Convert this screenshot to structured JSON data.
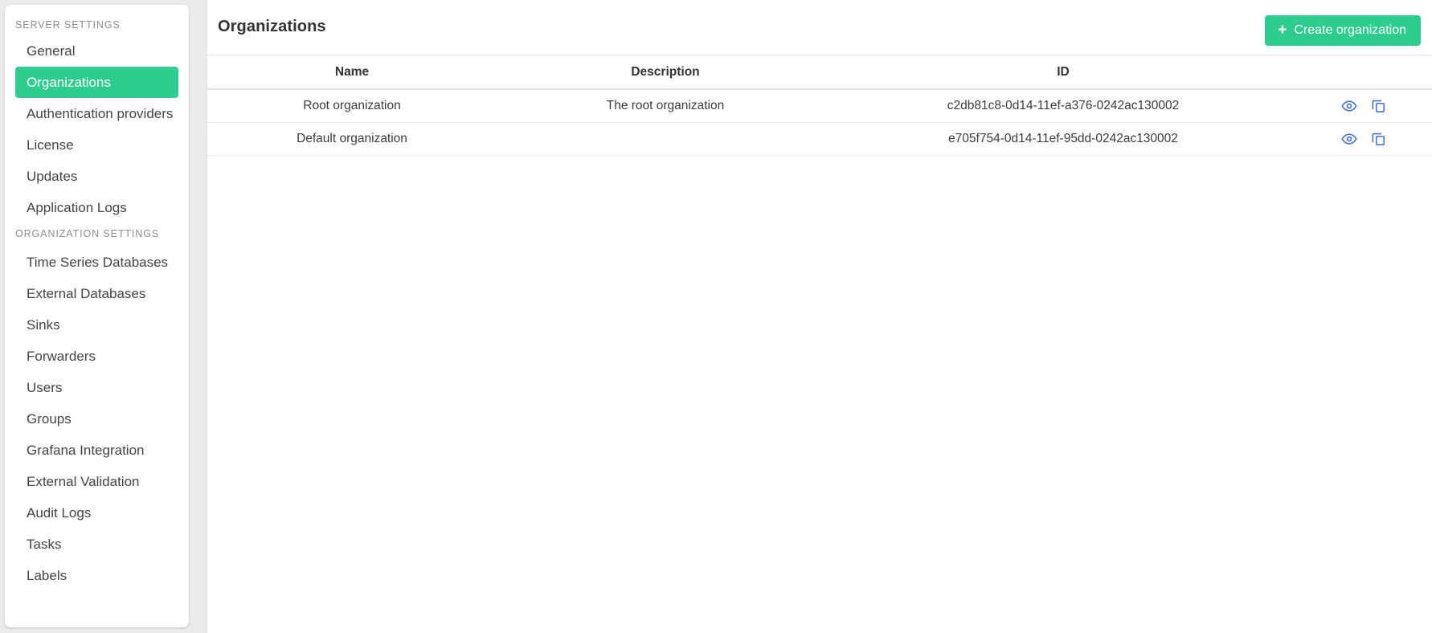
{
  "sidebar": {
    "sections": [
      {
        "title": "SERVER SETTINGS",
        "items": [
          {
            "label": "General",
            "active": false
          },
          {
            "label": "Organizations",
            "active": true
          },
          {
            "label": "Authentication providers",
            "active": false
          },
          {
            "label": "License",
            "active": false
          },
          {
            "label": "Updates",
            "active": false
          },
          {
            "label": "Application Logs",
            "active": false
          }
        ]
      },
      {
        "title": "ORGANIZATION SETTINGS",
        "items": [
          {
            "label": "Time Series Databases",
            "active": false
          },
          {
            "label": "External Databases",
            "active": false
          },
          {
            "label": "Sinks",
            "active": false
          },
          {
            "label": "Forwarders",
            "active": false
          },
          {
            "label": "Users",
            "active": false
          },
          {
            "label": "Groups",
            "active": false
          },
          {
            "label": "Grafana Integration",
            "active": false
          },
          {
            "label": "External Validation",
            "active": false
          },
          {
            "label": "Audit Logs",
            "active": false
          },
          {
            "label": "Tasks",
            "active": false
          },
          {
            "label": "Labels",
            "active": false
          }
        ]
      }
    ]
  },
  "header": {
    "title": "Organizations",
    "create_button": {
      "label": "Create organization",
      "icon": "plus-icon",
      "color": "#2ecc8f"
    }
  },
  "table": {
    "columns": [
      "Name",
      "Description",
      "ID",
      ""
    ],
    "rows": [
      {
        "name": "Root organization",
        "description": "The root organization",
        "id": "c2db81c8-0d14-11ef-a376-0242ac130002",
        "actions": [
          "view-icon",
          "copy-icon"
        ]
      },
      {
        "name": "Default organization",
        "description": "",
        "id": "e705f754-0d14-11ef-95dd-0242ac130002",
        "actions": [
          "view-icon",
          "copy-icon"
        ]
      }
    ]
  },
  "colors": {
    "accent_green": "#2ecc8f",
    "icon_blue": "#4a72d6",
    "page_background": "#ebebeb",
    "card_background": "#ffffff",
    "text_primary": "#333333",
    "section_label": "#8d8d8d"
  }
}
